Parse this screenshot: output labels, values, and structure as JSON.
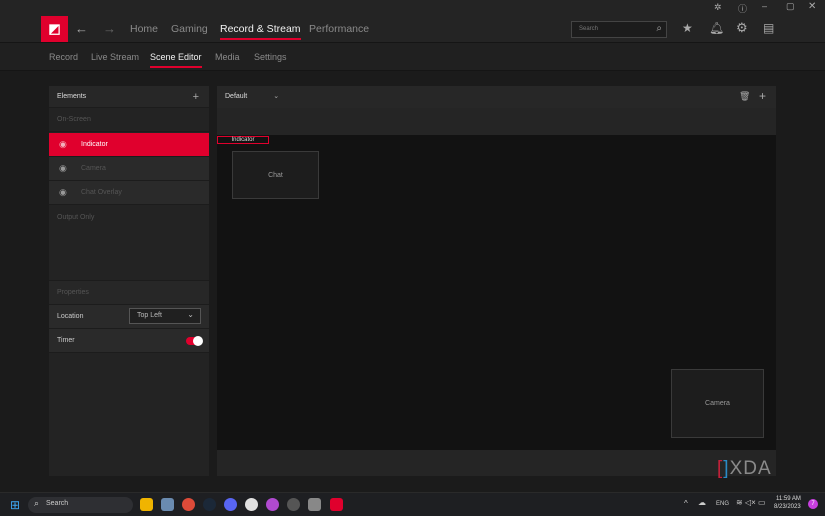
{
  "nav": {
    "tabs": [
      "Home",
      "Gaming",
      "Record & Stream",
      "Performance"
    ],
    "active": "Record & Stream"
  },
  "subnav": {
    "tabs": [
      "Record",
      "Live Stream",
      "Scene Editor",
      "Media",
      "Settings"
    ],
    "active": "Scene Editor"
  },
  "search": {
    "placeholder": "Search"
  },
  "elements": {
    "title": "Elements",
    "on_screen": "On-Screen",
    "items": [
      "Indicator",
      "Camera",
      "Chat Overlay"
    ],
    "selected": "Indicator",
    "output_only": "Output Only"
  },
  "properties": {
    "title": "Properties",
    "location_label": "Location",
    "location_value": "Top Left",
    "timer_label": "Timer",
    "timer_on": true
  },
  "scene": {
    "selected": "Default",
    "indicator_label": "Indicator",
    "chat_label": "Chat",
    "camera_label": "Camera"
  },
  "watermark": "XDA",
  "taskbar": {
    "search": "Search",
    "lang": "ENG",
    "time": "11:59 AM",
    "date": "8/23/2023",
    "badge": "7"
  },
  "colors": {
    "accent": "#e0002d"
  }
}
